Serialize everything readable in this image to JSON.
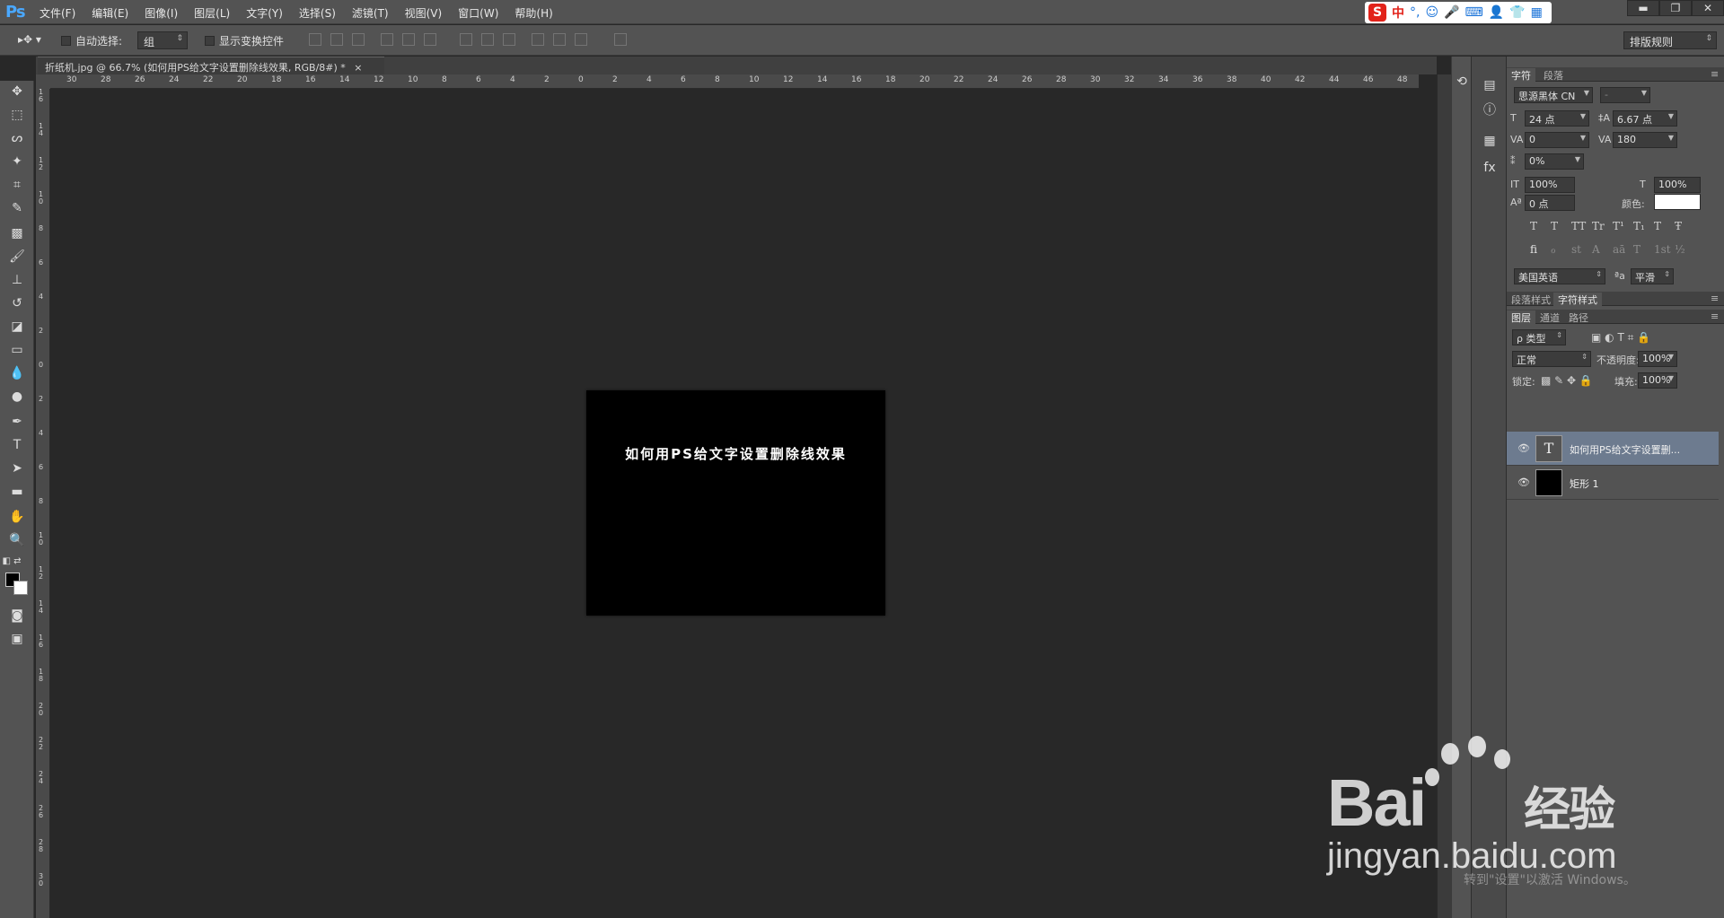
{
  "app": {
    "logo": "Ps"
  },
  "menu": [
    "文件(F)",
    "编辑(E)",
    "图像(I)",
    "图层(L)",
    "文字(Y)",
    "选择(S)",
    "滤镜(T)",
    "视图(V)",
    "窗口(W)",
    "帮助(H)"
  ],
  "ime": {
    "logo": "S",
    "lang": "中"
  },
  "window_controls": [
    "▬",
    "❐",
    "✕"
  ],
  "options": {
    "auto_select_label": "自动选择:",
    "auto_select_value": "组",
    "show_transform_label": "显示变换控件",
    "workspace": "排版规则"
  },
  "document": {
    "tab_title": "折纸机.jpg @ 66.7% (如何用PS给文字设置删除线效果, RGB/8#) *",
    "close": "×",
    "canvas_text": "如何用PS给文字设置删除线效果"
  },
  "ruler_top": [
    "30",
    "28",
    "26",
    "24",
    "22",
    "20",
    "18",
    "16",
    "14",
    "12",
    "10",
    "8",
    "6",
    "4",
    "2",
    "0",
    "2",
    "4",
    "6",
    "8",
    "10",
    "12",
    "14",
    "16",
    "18",
    "20",
    "22",
    "24",
    "26",
    "28",
    "30",
    "32",
    "34",
    "36",
    "38",
    "40",
    "42",
    "44",
    "46",
    "48"
  ],
  "ruler_left": [
    "16",
    "14",
    "12",
    "10",
    "8",
    "6",
    "4",
    "2",
    "0",
    "2",
    "4",
    "6",
    "8",
    "10",
    "12",
    "14",
    "16",
    "18",
    "20",
    "22",
    "24",
    "26",
    "28",
    "30"
  ],
  "character_panel": {
    "tabs": [
      "字符",
      "段落"
    ],
    "font_family": "思源黑体 CN",
    "font_style": "-",
    "font_size": "24 点",
    "leading": "6.67 点",
    "kerning": "0",
    "tracking": "180",
    "tsume": "0%",
    "vertical_scale": "100%",
    "horizontal_scale": "100%",
    "baseline_shift": "0 点",
    "color_label": "颜色:",
    "color": "#ffffff",
    "style_buttons": [
      "T",
      "T",
      "TT",
      "Tr",
      "T¹",
      "T₁",
      "T",
      "Ŧ"
    ],
    "opentype_buttons": [
      "fi",
      "ℴ",
      "st",
      "A",
      "aā",
      "T",
      "1st",
      "½"
    ],
    "language": "美国英语",
    "aa_icon": "ªa",
    "antialias": "平滑"
  },
  "styles_panel": {
    "tabs": [
      "段落样式",
      "字符样式"
    ]
  },
  "layers_panel": {
    "tabs": [
      "图层",
      "通道",
      "路径"
    ],
    "filter_kind": "ρ 类型",
    "blend_mode": "正常",
    "opacity_label": "不透明度:",
    "opacity": "100%",
    "lock_label": "锁定:",
    "fill_label": "填充:",
    "fill": "100%",
    "layers": [
      {
        "name": "如何用PS给文字设置删...",
        "type": "text",
        "thumb": "T",
        "selected": true
      },
      {
        "name": "矩形 1",
        "type": "shape",
        "thumb": "",
        "selected": false
      }
    ]
  },
  "watermark": {
    "brand": "Bai",
    "brand_cn": "经验",
    "url": "jingyan.baidu.com",
    "windows_notice": "转到\"设置\"以激活 Windows。"
  }
}
